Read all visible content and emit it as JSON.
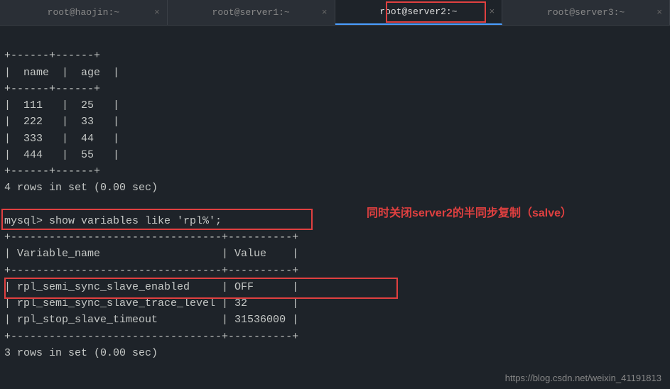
{
  "tabs": [
    {
      "label": "root@haojin:~",
      "active": false,
      "closeable": true
    },
    {
      "label": "root@server1:~",
      "active": false,
      "closeable": true
    },
    {
      "label": "root@server2:~",
      "active": true,
      "closeable": true
    },
    {
      "label": "root@server3:~",
      "active": false,
      "closeable": true
    }
  ],
  "table1": {
    "sep_top": "+------+------+",
    "header": "|  name  |  age  |",
    "sep_mid": "+------+------+",
    "rows": [
      "|  111   |  25   |",
      "|  222   |  33   |",
      "|  333   |  44   |",
      "|  444   |  55   |"
    ],
    "sep_bot": "+------+------+",
    "summary": "4 rows in set (0.00 sec)"
  },
  "blank1": "",
  "prompt_cmd": "mysql> show variables like 'rpl%';",
  "table2": {
    "sep_top": "+---------------------------------+----------+",
    "header": "| Variable_name                   | Value    |",
    "sep_mid": "+---------------------------------+----------+",
    "rows": [
      "| rpl_semi_sync_slave_enabled     | OFF      |",
      "| rpl_semi_sync_slave_trace_level | 32       |",
      "| rpl_stop_slave_timeout          | 31536000 |"
    ],
    "sep_bot": "+---------------------------------+----------+",
    "summary": "3 rows in set (0.00 sec)"
  },
  "annotation": "同时关闭server2的半同步复制（salve）",
  "watermark": "https://blog.csdn.net/weixin_41191813",
  "close_glyph": "×"
}
